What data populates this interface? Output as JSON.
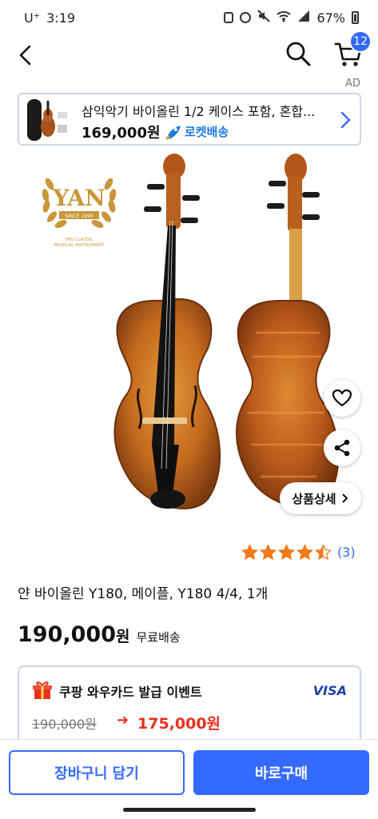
{
  "status_bar": {
    "carrier": "U⁺",
    "time": "3:19",
    "battery": "67%"
  },
  "header": {
    "cart_count": "12"
  },
  "ad": {
    "label": "AD",
    "title": "삼익악기 바이올린 1/2 케이스 포함, 혼합...",
    "price": "169,000원",
    "delivery": "로켓배송"
  },
  "product_image": {
    "logo_text": "YAN",
    "logo_since": "SINCE 1996",
    "logo_sub1": "YAN CLASSIC",
    "logo_sub2": "MUSICAL INSTRUMENT",
    "detail_button": "상품상세"
  },
  "rating": {
    "stars": 4.5,
    "max_stars": 5,
    "count": "(3)"
  },
  "product": {
    "name": "얀 바이올린 Y180, 메이플, Y180 4/4, 1개",
    "price": "190,000",
    "price_unit": "원",
    "shipping": "무료배송"
  },
  "card_event": {
    "title": "쿠팡 와우카드 발급 이벤트",
    "card_brand": "VISA",
    "original_price": "190,000원",
    "arrow": "➜",
    "sale_price": "175,000원"
  },
  "bottom": {
    "add_to_cart": "장바구니 담기",
    "buy_now": "바로구매"
  },
  "colors": {
    "accent": "#346aff",
    "sale": "#e8301d",
    "star": "#f07a1c"
  }
}
